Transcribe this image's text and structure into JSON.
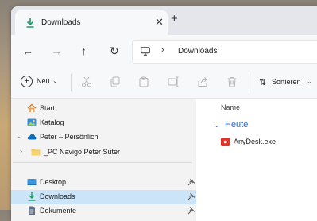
{
  "tab": {
    "title": "Downloads",
    "close": "✕",
    "new_tab": "+"
  },
  "nav": {
    "back": "←",
    "forward": "→",
    "up": "↑",
    "refresh": "↻"
  },
  "address": {
    "separator": "›",
    "location": "Downloads"
  },
  "toolbar": {
    "new_label": "Neu",
    "sort_label": "Sortieren",
    "dropdown": "⌄"
  },
  "sidebar": {
    "items": [
      {
        "label": "Start",
        "icon": "home-icon"
      },
      {
        "label": "Katalog",
        "icon": "gallery-icon"
      },
      {
        "label": "Peter – Persönlich",
        "icon": "onedrive-cloud-icon",
        "expanded": true
      },
      {
        "label": "_PC Navigo Peter Suter",
        "icon": "folder-icon",
        "expanded": false
      }
    ],
    "pinned": [
      {
        "label": "Desktop",
        "icon": "desktop-icon"
      },
      {
        "label": "Downloads",
        "icon": "download-icon",
        "selected": true
      },
      {
        "label": "Dokumente",
        "icon": "document-icon"
      }
    ],
    "expand_arrow": "›",
    "collapse_arrow": "⌄"
  },
  "main": {
    "column_header": "Name",
    "group": {
      "label": "Heute",
      "chevron": "⌄"
    },
    "files": [
      {
        "name": "AnyDesk.exe",
        "icon": "anydesk-app-icon"
      }
    ]
  },
  "colors": {
    "accent": "#2a62c9",
    "selected_bg": "#cce4f7",
    "download_green": "#1e9e6a",
    "anydesk_red": "#e0342b"
  }
}
